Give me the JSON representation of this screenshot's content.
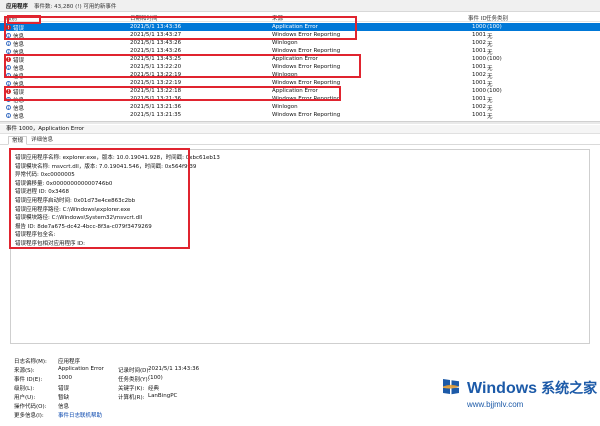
{
  "toolbar": {
    "title": "应用程序",
    "event_count": "事件数: 43,280 (!) 可用的新事件"
  },
  "columns": {
    "level": "级别",
    "datetime": "日期和时间",
    "source": "来源",
    "event_id": "事件 ID",
    "task": "任务类别"
  },
  "rows": [
    {
      "level": "错误",
      "type": "error",
      "datetime": "2021/5/1 13:43:36",
      "source": "Application Error",
      "event_id": "1000",
      "task": "(100)"
    },
    {
      "level": "信息",
      "type": "info",
      "datetime": "2021/5/1 13:43:27",
      "source": "Windows Error Reporting",
      "event_id": "1001",
      "task": "无"
    },
    {
      "level": "信息",
      "type": "info",
      "datetime": "2021/5/1 13:43:26",
      "source": "Winlogon",
      "event_id": "1002",
      "task": "无"
    },
    {
      "level": "信息",
      "type": "info",
      "datetime": "2021/5/1 13:43:26",
      "source": "Windows Error Reporting",
      "event_id": "1001",
      "task": "无"
    },
    {
      "level": "错误",
      "type": "error",
      "datetime": "2021/5/1 13:43:25",
      "source": "Application Error",
      "event_id": "1000",
      "task": "(100)"
    },
    {
      "level": "信息",
      "type": "info",
      "datetime": "2021/5/1 13:22:20",
      "source": "Windows Error Reporting",
      "event_id": "1001",
      "task": "无"
    },
    {
      "level": "信息",
      "type": "info",
      "datetime": "2021/5/1 13:22:19",
      "source": "Winlogon",
      "event_id": "1002",
      "task": "无"
    },
    {
      "level": "信息",
      "type": "info",
      "datetime": "2021/5/1 13:22:19",
      "source": "Windows Error Reporting",
      "event_id": "1001",
      "task": "无"
    },
    {
      "level": "错误",
      "type": "error",
      "datetime": "2021/5/1 13:22:18",
      "source": "Application Error",
      "event_id": "1000",
      "task": "(100)"
    },
    {
      "level": "信息",
      "type": "info",
      "datetime": "2021/5/1 13:21:36",
      "source": "Windows Error Reporting",
      "event_id": "1001",
      "task": "无"
    },
    {
      "level": "信息",
      "type": "info",
      "datetime": "2021/5/1 13:21:36",
      "source": "Winlogon",
      "event_id": "1002",
      "task": "无"
    },
    {
      "level": "信息",
      "type": "info",
      "datetime": "2021/5/1 13:21:35",
      "source": "Windows Error Reporting",
      "event_id": "1001",
      "task": "无"
    }
  ],
  "detail": {
    "title": "事件 1000，Application Error",
    "tab_general": "常规",
    "tab_details": "详细信息",
    "lines": [
      "错误应用程序名称: explorer.exe，版本: 10.0.19041.928，时间戳: 0xbc61eb13",
      "错误模块名称: msvcrt.dll，版本: 7.0.19041.546，时间戳: 0x564f9f39",
      "异常代码: 0xc0000005",
      "错误偏移量: 0x000000000000746b0",
      "错误进程 ID: 0x3468",
      "错误应用程序启动时间: 0x01d73e4ce863c2bb",
      "错误应用程序路径: C:\\Windows\\explorer.exe",
      "错误模块路径: C:\\Windows\\System32\\msvcrt.dll",
      "报告 ID: 8de7a675-dc42-4bcc-8f3a-c079f3479269",
      "错误程序包全名:",
      "错误程序包相对应用程序 ID:"
    ]
  },
  "properties": {
    "log_name_label": "日志名称(M):",
    "log_name": "应用程序",
    "source_label": "来源(S):",
    "source": "Application Error",
    "logged_label": "记录时间(D):",
    "logged": "2021/5/1 13:43:36",
    "event_id_label": "事件 ID(E):",
    "event_id": "1000",
    "task_label": "任务类别(Y):",
    "task": "(100)",
    "level_label": "级别(L):",
    "level": "错误",
    "keywords_label": "关键字(K):",
    "keywords": "经典",
    "user_label": "用户(U):",
    "user": "暂缺",
    "computer_label": "计算机(R):",
    "computer": "LanBingPC",
    "opcode_label": "操作代码(O):",
    "opcode": "信息",
    "more_info_label": "更多信息(I):",
    "more_info": "事件日志联机帮助"
  },
  "watermark": {
    "brand": "Windows",
    "cn": "系统之家",
    "url": "www.bjjmlv.com"
  },
  "colors": {
    "selection": "#0078d7",
    "highlight": "#e0242f",
    "error": "#d32020",
    "brand": "#1c5aa8"
  }
}
